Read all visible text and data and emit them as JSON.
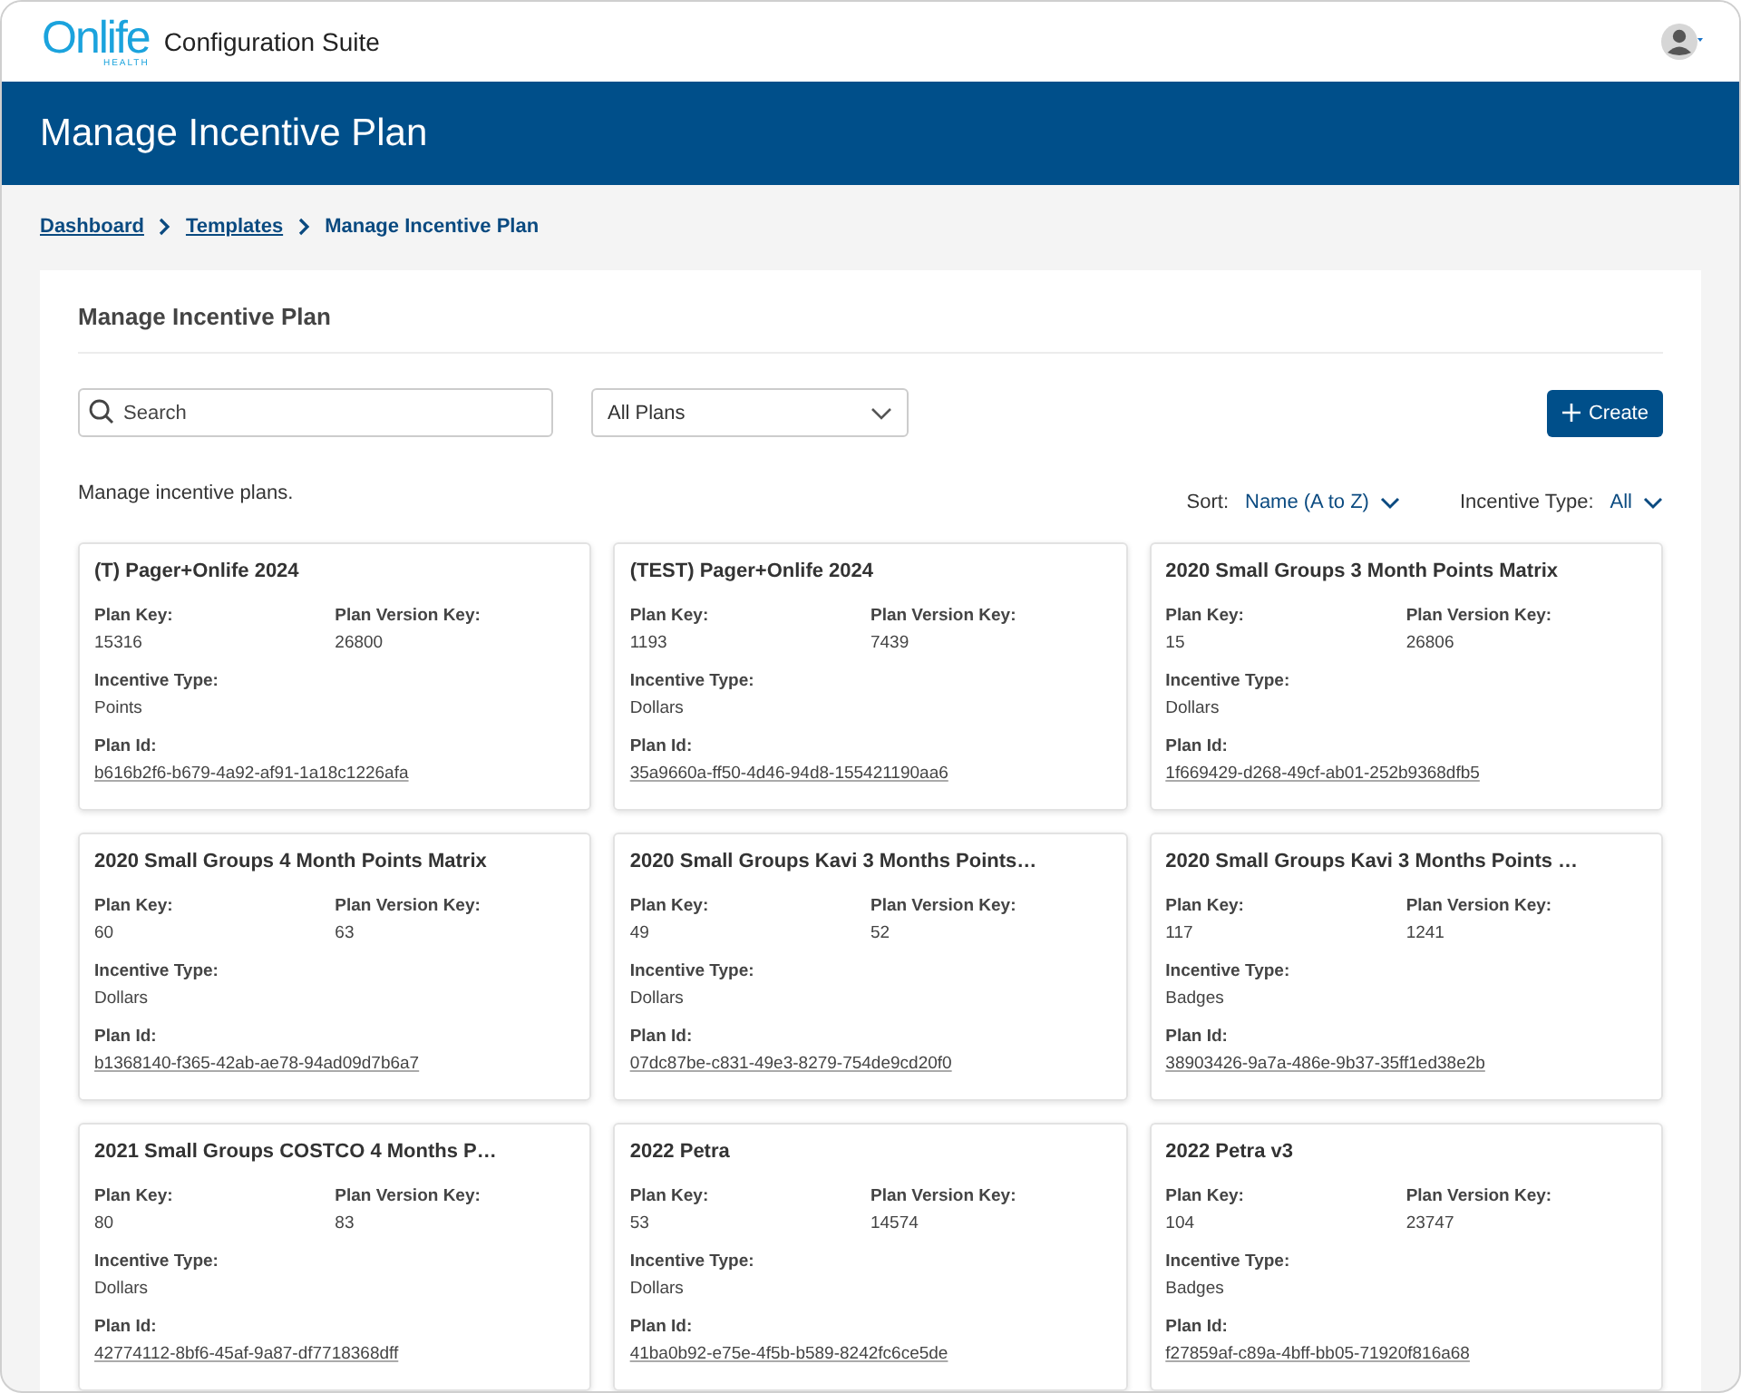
{
  "header": {
    "logo": {
      "text": "Onlife",
      "subtext": "HEALTH"
    },
    "app_title": "Configuration Suite"
  },
  "banner": {
    "title": "Manage Incentive Plan"
  },
  "breadcrumb": [
    {
      "label": "Dashboard",
      "link": true
    },
    {
      "label": "Templates",
      "link": true
    },
    {
      "label": "Manage Incentive Plan",
      "link": false
    }
  ],
  "panel": {
    "title": "Manage Incentive Plan",
    "search": {
      "placeholder": "Search"
    },
    "plan_filter": {
      "value": "All Plans"
    },
    "create_button": "Create",
    "description": "Manage incentive plans.",
    "sort": {
      "label": "Sort:",
      "value": "Name (A to Z)"
    },
    "incentive_filter": {
      "label": "Incentive Type:",
      "value": "All"
    }
  },
  "cards": [
    {
      "title": "(T) Pager+Onlife 2024",
      "plan_key_label": "Plan Key:",
      "plan_key": "15316",
      "version_key_label": "Plan Version Key:",
      "version_key": "26800",
      "type_label": "Incentive Type:",
      "type": "Points",
      "id_label": "Plan Id:",
      "plan_id": "b616b2f6-b679-4a92-af91-1a18c1226afa"
    },
    {
      "title": "(TEST) Pager+Onlife 2024",
      "plan_key_label": "Plan Key:",
      "plan_key": "1193",
      "version_key_label": "Plan Version Key:",
      "version_key": "7439",
      "type_label": "Incentive Type:",
      "type": "Dollars",
      "id_label": "Plan Id:",
      "plan_id": "35a9660a-ff50-4d46-94d8-155421190aa6"
    },
    {
      "title": "2020 Small Groups 3 Month Points Matrix",
      "plan_key_label": "Plan Key:",
      "plan_key": "15",
      "version_key_label": "Plan Version Key:",
      "version_key": "26806",
      "type_label": "Incentive Type:",
      "type": "Dollars",
      "id_label": "Plan Id:",
      "plan_id": "1f669429-d268-49cf-ab01-252b9368dfb5"
    },
    {
      "title": "2020 Small Groups 4 Month Points Matrix",
      "plan_key_label": "Plan Key:",
      "plan_key": "60",
      "version_key_label": "Plan Version Key:",
      "version_key": "63",
      "type_label": "Incentive Type:",
      "type": "Dollars",
      "id_label": "Plan Id:",
      "plan_id": "b1368140-f365-42ab-ae78-94ad09d7b6a7"
    },
    {
      "title": "2020 Small Groups Kavi 3 Months Points…",
      "plan_key_label": "Plan Key:",
      "plan_key": "49",
      "version_key_label": "Plan Version Key:",
      "version_key": "52",
      "type_label": "Incentive Type:",
      "type": "Dollars",
      "id_label": "Plan Id:",
      "plan_id": "07dc87be-c831-49e3-8279-754de9cd20f0"
    },
    {
      "title": "2020 Small Groups Kavi 3 Months Points …",
      "plan_key_label": "Plan Key:",
      "plan_key": "117",
      "version_key_label": "Plan Version Key:",
      "version_key": "1241",
      "type_label": "Incentive Type:",
      "type": "Badges",
      "id_label": "Plan Id:",
      "plan_id": "38903426-9a7a-486e-9b37-35ff1ed38e2b"
    },
    {
      "title": "2021 Small Groups COSTCO 4 Months P…",
      "plan_key_label": "Plan Key:",
      "plan_key": "80",
      "version_key_label": "Plan Version Key:",
      "version_key": "83",
      "type_label": "Incentive Type:",
      "type": "Dollars",
      "id_label": "Plan Id:",
      "plan_id": "42774112-8bf6-45af-9a87-df7718368dff"
    },
    {
      "title": "2022 Petra",
      "plan_key_label": "Plan Key:",
      "plan_key": "53",
      "version_key_label": "Plan Version Key:",
      "version_key": "14574",
      "type_label": "Incentive Type:",
      "type": "Dollars",
      "id_label": "Plan Id:",
      "plan_id": "41ba0b92-e75e-4f5b-b589-8242fc6ce5de"
    },
    {
      "title": "2022 Petra v3",
      "plan_key_label": "Plan Key:",
      "plan_key": "104",
      "version_key_label": "Plan Version Key:",
      "version_key": "23747",
      "type_label": "Incentive Type:",
      "type": "Badges",
      "id_label": "Plan Id:",
      "plan_id": "f27859af-c89a-4bff-bb05-71920f816a68"
    }
  ]
}
